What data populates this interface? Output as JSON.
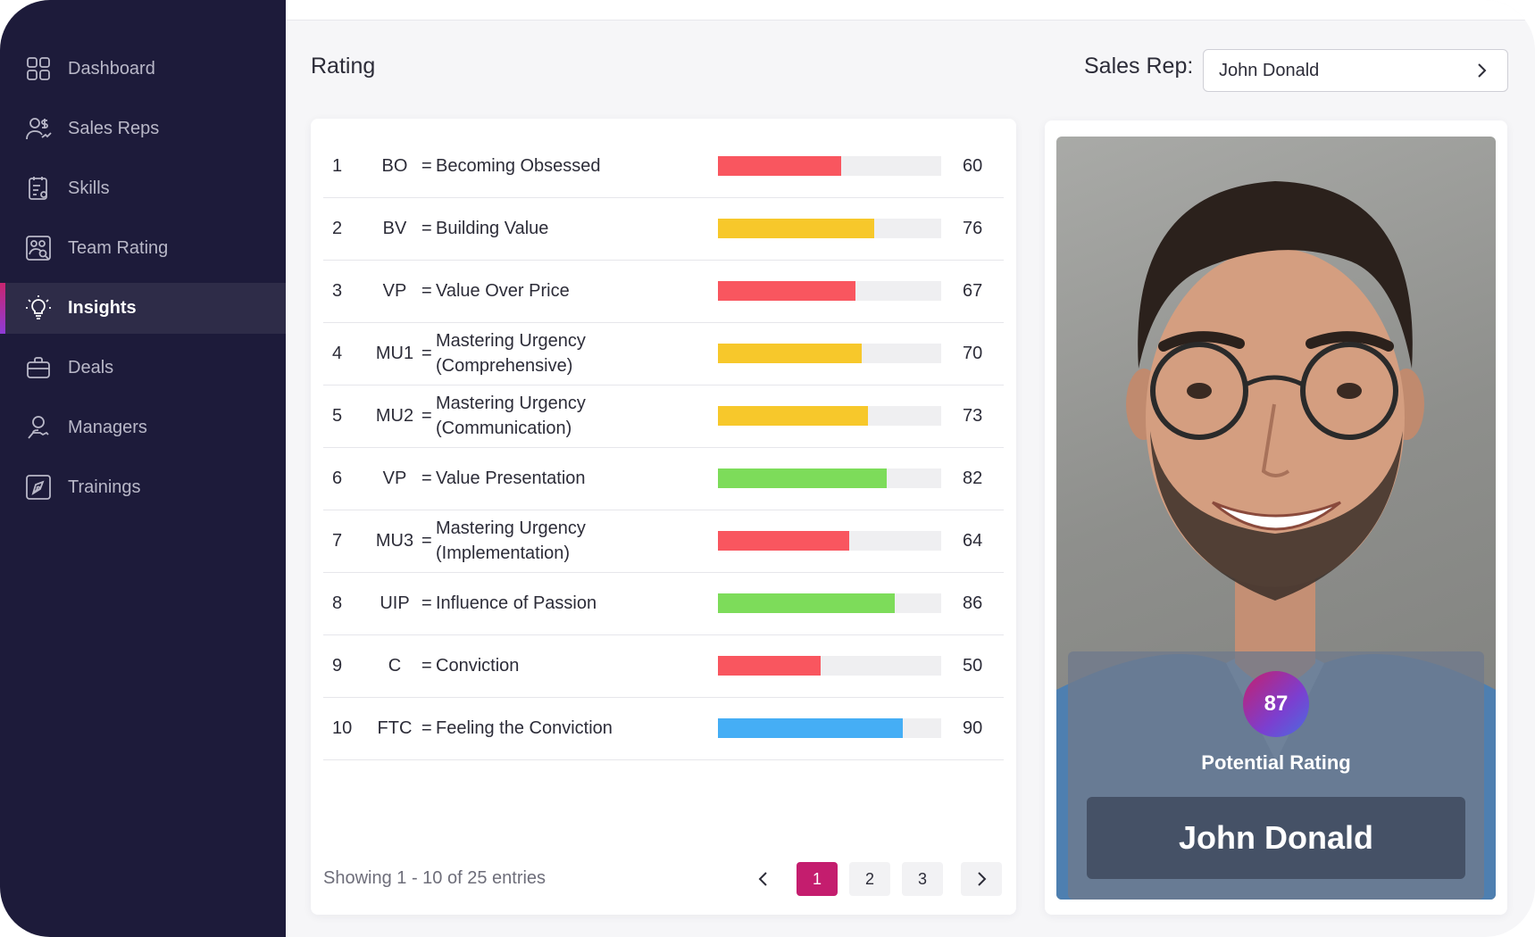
{
  "sidebar": {
    "items": [
      {
        "label": "Dashboard",
        "icon": "grid-icon"
      },
      {
        "label": "Sales Reps",
        "icon": "users-dollar-icon"
      },
      {
        "label": "Skills",
        "icon": "clipboard-list-icon"
      },
      {
        "label": "Team Rating",
        "icon": "team-rating-icon"
      },
      {
        "label": "Insights",
        "icon": "lightbulb-icon",
        "active": true
      },
      {
        "label": "Deals",
        "icon": "briefcase-icon"
      },
      {
        "label": "Managers",
        "icon": "manager-icon"
      },
      {
        "label": "Trainings",
        "icon": "pen-nib-icon"
      }
    ]
  },
  "header": {
    "title": "Rating",
    "sales_rep_label": "Sales Rep:",
    "sales_rep_value": "John Donald"
  },
  "ratings": [
    {
      "num": "1",
      "code": "BO",
      "eq": "=",
      "name": "Becoming Obsessed",
      "score": 60,
      "color": "#f9565f"
    },
    {
      "num": "2",
      "code": "BV",
      "eq": "=",
      "name": "Building Value",
      "score": 76,
      "color": "#f7c82b"
    },
    {
      "num": "3",
      "code": "VP",
      "eq": "=",
      "name": "Value Over Price",
      "score": 67,
      "color": "#f9565f"
    },
    {
      "num": "4",
      "code": "MU1",
      "eq": "=",
      "name": "Mastering Urgency (Comprehensive)",
      "score": 70,
      "color": "#f7c82b"
    },
    {
      "num": "5",
      "code": "MU2",
      "eq": "=",
      "name": "Mastering Urgency (Communication)",
      "score": 73,
      "color": "#f7c82b"
    },
    {
      "num": "6",
      "code": "VP",
      "eq": "=",
      "name": "Value Presentation",
      "score": 82,
      "color": "#7ddc5a"
    },
    {
      "num": "7",
      "code": "MU3",
      "eq": "=",
      "name": "Mastering Urgency (Implementation)",
      "score": 64,
      "color": "#f9565f"
    },
    {
      "num": "8",
      "code": "UIP",
      "eq": "=",
      "name": "Influence of Passion",
      "score": 86,
      "color": "#7ddc5a"
    },
    {
      "num": "9",
      "code": "C",
      "eq": "=",
      "name": "Conviction",
      "score": 50,
      "color": "#f9565f"
    },
    {
      "num": "10",
      "code": "FTC",
      "eq": "=",
      "name": "Feeling the Conviction",
      "score": 90,
      "color": "#45aef5"
    }
  ],
  "bar_max": 100,
  "footer": {
    "showing": "Showing 1 - 10 of 25 entries",
    "pages": [
      "1",
      "2",
      "3"
    ],
    "current_page": "1"
  },
  "profile": {
    "score": "87",
    "score_label": "Potential Rating",
    "name": "John Donald"
  },
  "colors": {
    "sidebar_bg": "#1d1b3a",
    "accent": "#c41d6e",
    "red": "#f9565f",
    "yellow": "#f7c82b",
    "green": "#7ddc5a",
    "blue": "#45aef5"
  }
}
